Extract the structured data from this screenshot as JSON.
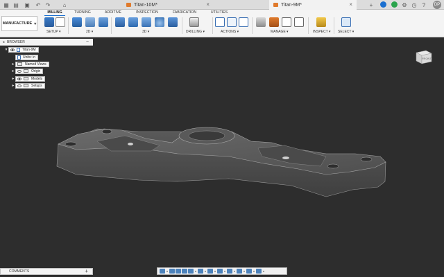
{
  "topbar": {
    "tabs": [
      {
        "title": "Titan-10M*",
        "active": false
      },
      {
        "title": "Titan-9M*",
        "active": true
      }
    ],
    "user_initials": "DP",
    "colors": {
      "doc_icon": "#e07a2c",
      "help": "#1a6fd0",
      "online": "#2aa44c"
    }
  },
  "toolbar": {
    "workspace_label": "MANUFACTURE",
    "tabs": [
      "MILLING",
      "TURNING",
      "ADDITIVE",
      "INSPECTION",
      "FABRICATION",
      "UTILITIES"
    ],
    "active_tab": "MILLING",
    "groups": [
      "SETUP ▾",
      "2D ▾",
      "3D ▾",
      "DRILLING ▾",
      "ACTIONS ▾",
      "MANAGE ▾",
      "INSPECT ▾",
      "SELECT ▾"
    ]
  },
  "browser": {
    "title": "BROWSER",
    "nodes": [
      {
        "label": "Titan-9M",
        "icon": "document-icon"
      },
      {
        "label": "Units: in",
        "icon": "document-icon"
      },
      {
        "label": "Named Views",
        "icon": "folder-icon"
      },
      {
        "label": "Origin",
        "icon": "folder-icon"
      },
      {
        "label": "Models",
        "icon": "folder-icon"
      },
      {
        "label": "Setups",
        "icon": "folder-icon"
      }
    ]
  },
  "viewcube": {
    "face_label": "FRONT"
  },
  "comments": {
    "title": "COMMENTS"
  },
  "viewport": {
    "background": "#2d2d2d",
    "model_color": "#5e5e5e"
  }
}
